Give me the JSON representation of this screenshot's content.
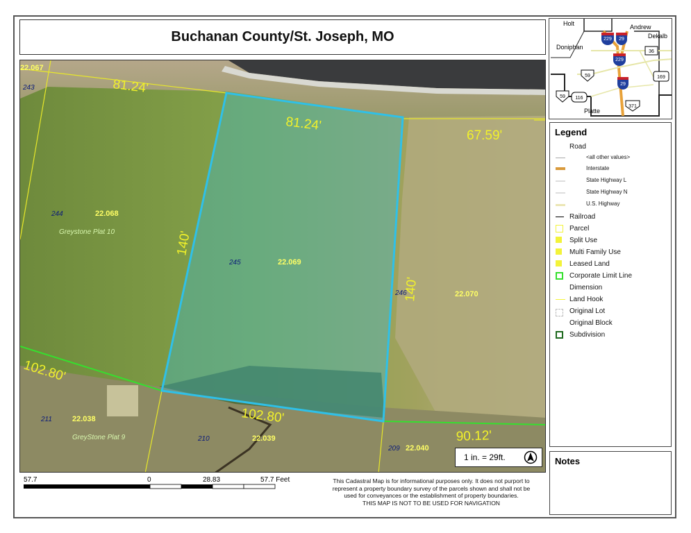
{
  "title": "Buchanan County/St. Joseph, MO",
  "map": {
    "dimensions": {
      "top_outer": "81.24'",
      "top_parcel": "81.24'",
      "top_right": "67.59'",
      "left_side": "140'",
      "right_side": "140'",
      "bottom_left": "102.80'",
      "bottom_parcel": "102.80'",
      "bottom_right": "90.12'"
    },
    "lots": {
      "l243": "243",
      "l244": "244",
      "l245": "245",
      "l246": "246",
      "l211": "211",
      "l210": "210",
      "l209": "209"
    },
    "parcels": {
      "p22067": "22.067",
      "p22068": "22.068",
      "p22069": "22.069",
      "p22070": "22.070",
      "p22038": "22.038",
      "p22039": "22.039",
      "p22040": "22.040"
    },
    "plats": {
      "plat10": "Greystone Plat 10",
      "plat9": "GreyStone Plat 9"
    },
    "highlight_color": "#2fc0e8"
  },
  "scale_text": "1 in. = 29ft.",
  "scale_bar": {
    "left": "57.7",
    "zero": "0",
    "mid": "28.83",
    "right": "57.7 Feet"
  },
  "disclaimer": {
    "line1": "This Cadastral Map is for informational purposes only.  It does not purport to",
    "line2": "represent a property boundary survey of the parcels shown and shall not be",
    "line3": "used for conveyances or the establishment of property boundaries.",
    "line4": "THIS MAP IS NOT TO BE USED FOR NAVIGATION"
  },
  "locator": {
    "holt": "Holt",
    "andrew": "Andrew",
    "dekalb": "Dekalb",
    "doniphan": "Doniphan",
    "platte": "Platte",
    "i229a": "229",
    "i29a": "29",
    "i229b": "229",
    "i29b": "29",
    "us36": "36",
    "us59a": "59",
    "us169": "169",
    "us59b": "59",
    "us116": "116",
    "us371": "371"
  },
  "legend": {
    "title": "Legend",
    "road": "Road",
    "all_other": "<all other values>",
    "interstate": "Interstate",
    "state_l": "State Highway L",
    "state_n": "State Highway N",
    "us_highway": "U.S. Highway",
    "railroad": "Railroad",
    "parcel": "Parcel",
    "split_use": "Split Use",
    "multi_family": "Multi Family Use",
    "leased_land": "Leased Land",
    "corporate": "Corporate Limit Line",
    "dimension": "Dimension",
    "land_hook": "Land Hook",
    "original_lot": "Original Lot",
    "original_block": "Original Block",
    "subdivision": "Subdivision"
  },
  "notes_title": "Notes"
}
